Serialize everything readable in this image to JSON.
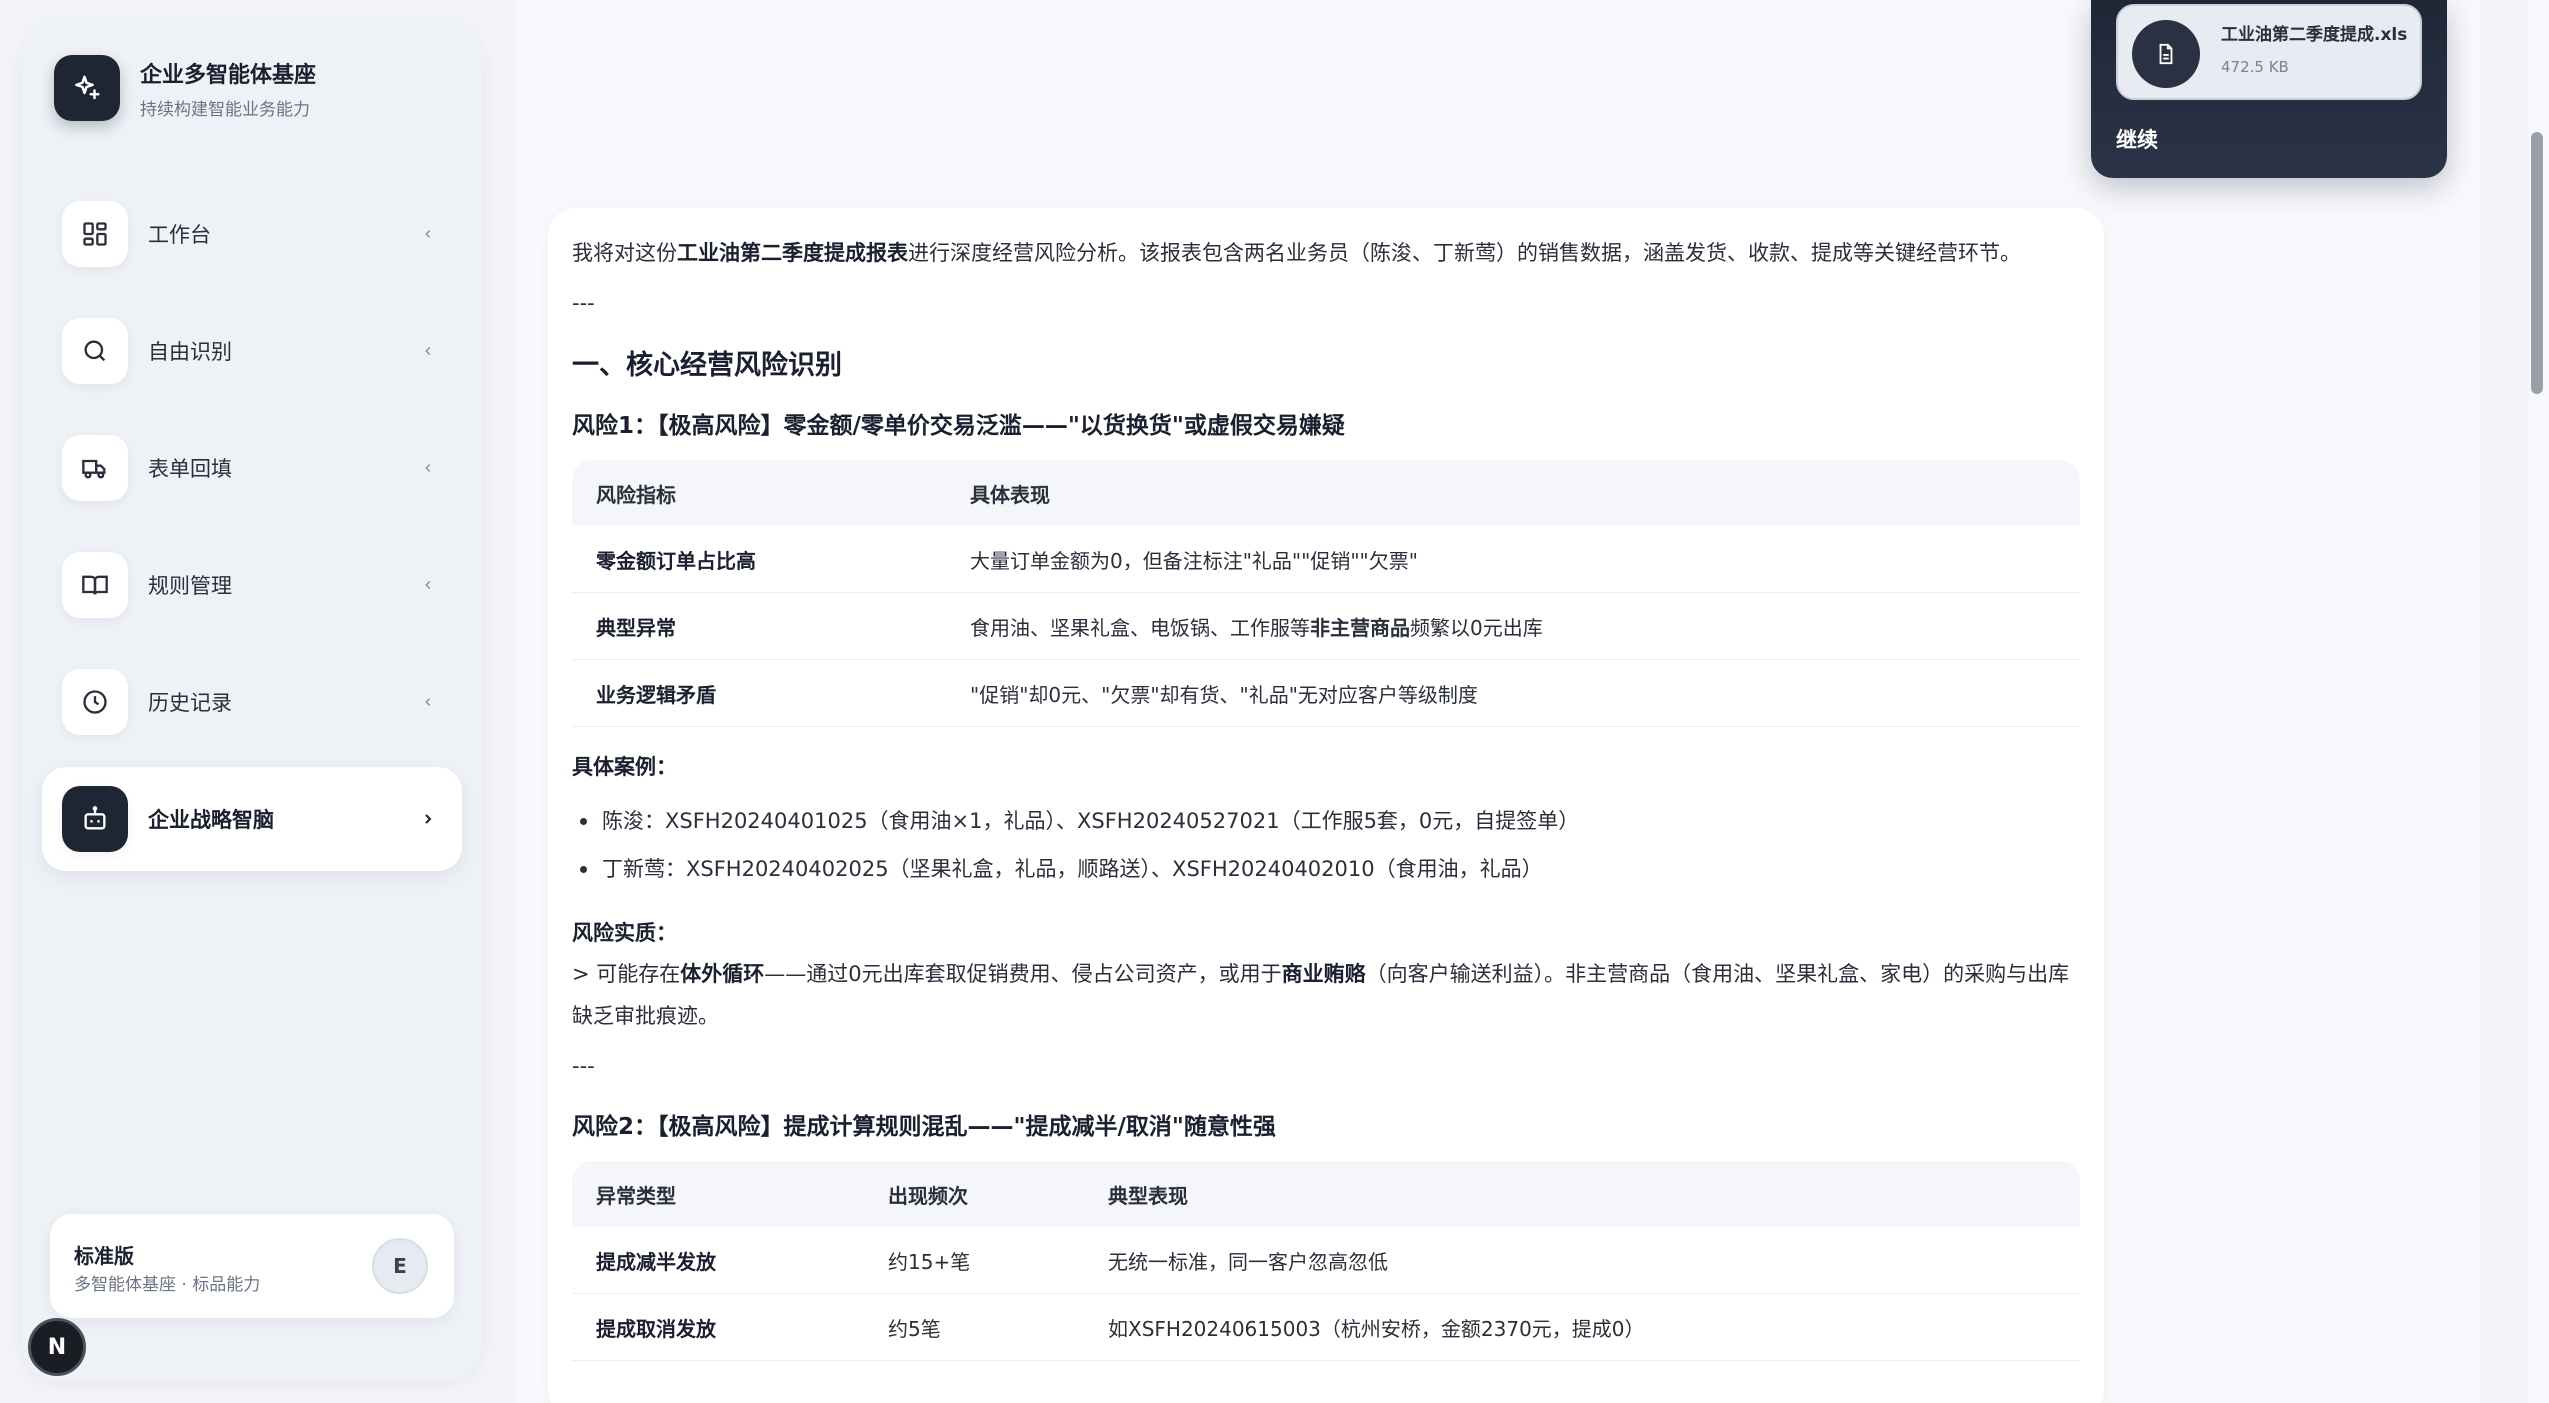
{
  "brand": {
    "title": "企业多智能体基座",
    "subtitle": "持续构建智能业务能力",
    "logo_icon": "sparkle-icon"
  },
  "nav": {
    "items": [
      {
        "label": "工作台",
        "icon": "dashboard-grid-icon",
        "active": false
      },
      {
        "label": "自由识别",
        "icon": "search-icon",
        "active": false
      },
      {
        "label": "表单回填",
        "icon": "truck-icon",
        "active": false
      },
      {
        "label": "规则管理",
        "icon": "book-open-icon",
        "active": false
      },
      {
        "label": "历史记录",
        "icon": "clock-icon",
        "active": false
      },
      {
        "label": "企业战略智脑",
        "icon": "robot-icon",
        "active": true
      }
    ]
  },
  "plan": {
    "name": "标准版",
    "desc": "多智能体基座 · 标品能力",
    "avatar": "E"
  },
  "n_badge": "N",
  "attachment": {
    "file_name": "工业油第二季度提成.xls",
    "file_size": "472.5 KB",
    "continue_label": "继续"
  },
  "content": {
    "intro_pre": "我将对这份",
    "intro_bold": "工业油第二季度提成报表",
    "intro_post": "进行深度经营风险分析。该报表包含两名业务员（陈浚、丁新莺）的销售数据，涵盖发货、收款、提成等关键经营环节。",
    "sep": "---",
    "section1_title": "一、核心经营风险识别",
    "risk1_title": "风险1：【极高风险】零金额/零单价交易泛滥——\"以货换货\"或虚假交易嫌疑",
    "table1": {
      "headers": [
        "风险指标",
        "具体表现"
      ],
      "rows": [
        {
          "c1": "零金额订单占比高",
          "c2_pre": "大量订单金额为0，但备注标注\"礼品\"\"促销\"\"欠票\"",
          "c2_bold": "",
          "c2_post": ""
        },
        {
          "c1": "典型异常",
          "c2_pre": "食用油、坚果礼盒、电饭锅、工作服等",
          "c2_bold": "非主营商品",
          "c2_post": "频繁以0元出库"
        },
        {
          "c1": "业务逻辑矛盾",
          "c2_pre": "\"促销\"却0元、\"欠票\"却有货、\"礼品\"无对应客户等级制度",
          "c2_bold": "",
          "c2_post": ""
        }
      ]
    },
    "cases_label": "具体案例：",
    "cases": [
      "陈浚：XSFH20240401025（食用油×1，礼品）、XSFH20240527021（工作服5套，0元，自提签单）",
      "丁新莺：XSFH20240402025（坚果礼盒，礼品，顺路送）、XSFH20240402010（食用油，礼品）"
    ],
    "essence_label": "风险实质：",
    "essence": {
      "p1": "> 可能存在",
      "b1": "体外循环",
      "p2": "——通过0元出库套取促销费用、侵占公司资产，或用于",
      "b2": "商业贿赂",
      "p3": "（向客户输送利益）。非主营商品（食用油、坚果礼盒、家电）的采购与出库缺乏审批痕迹。"
    },
    "risk2_title": "风险2：【极高风险】提成计算规则混乱——\"提成减半/取消\"随意性强",
    "table2": {
      "headers": [
        "异常类型",
        "出现频次",
        "典型表现"
      ],
      "rows": [
        [
          "提成减半发放",
          "约15+笔",
          "无统一标准，同一客户忽高忽低"
        ],
        [
          "提成取消发放",
          "约5笔",
          "如XSFH20240615003（杭州安桥，金额2370元，提成0）"
        ]
      ]
    }
  }
}
